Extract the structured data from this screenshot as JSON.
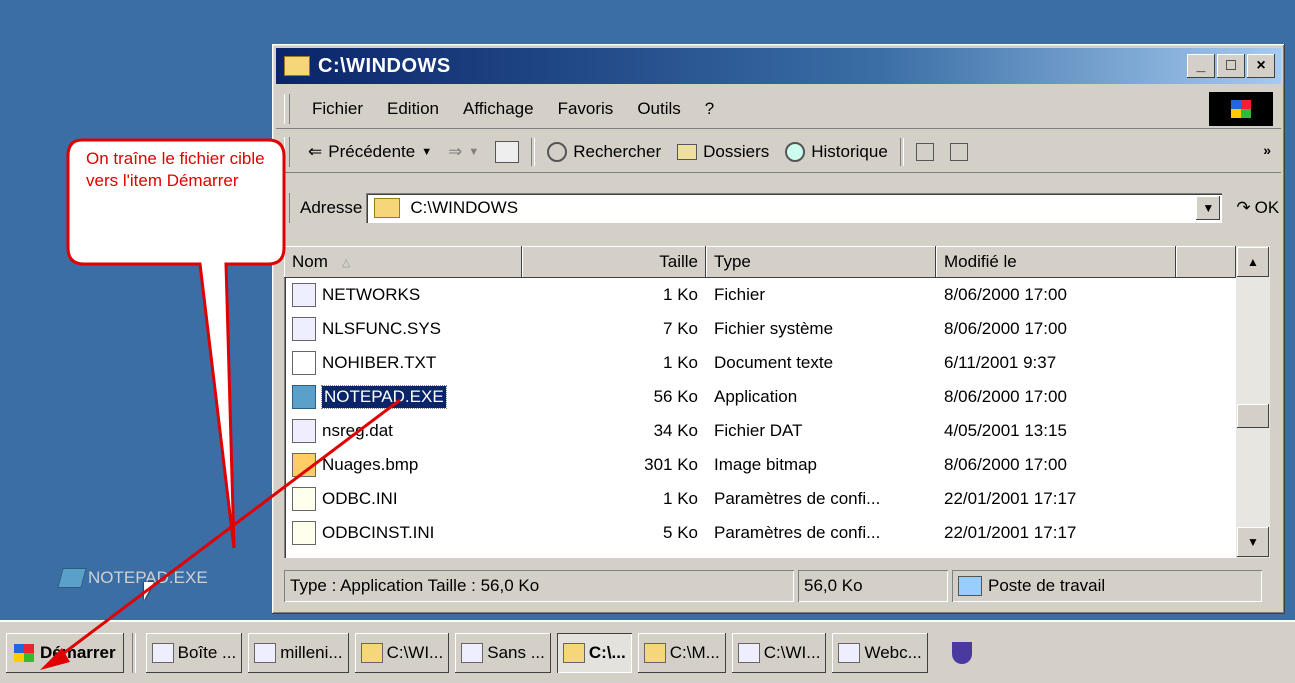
{
  "window": {
    "title": "C:\\WINDOWS",
    "min": "_",
    "max": "□",
    "close": "×"
  },
  "menu": {
    "items": [
      "Fichier",
      "Edition",
      "Affichage",
      "Favoris",
      "Outils",
      "?"
    ]
  },
  "toolbar": {
    "back": "Précédente",
    "search": "Rechercher",
    "folders": "Dossiers",
    "history": "Historique"
  },
  "address": {
    "label": "Adresse",
    "value": "C:\\WINDOWS",
    "go": "OK"
  },
  "columns": {
    "name": "Nom",
    "size": "Taille",
    "type": "Type",
    "modified": "Modifié le"
  },
  "files": [
    {
      "name": "NETWORKS",
      "size": "1 Ko",
      "type": "Fichier",
      "modified": "8/06/2000 17:00"
    },
    {
      "name": "NLSFUNC.SYS",
      "size": "7 Ko",
      "type": "Fichier système",
      "modified": "8/06/2000 17:00"
    },
    {
      "name": "NOHIBER.TXT",
      "size": "1 Ko",
      "type": "Document texte",
      "modified": "6/11/2001 9:37"
    },
    {
      "name": "NOTEPAD.EXE",
      "size": "56 Ko",
      "type": "Application",
      "modified": "8/06/2000 17:00"
    },
    {
      "name": "nsreg.dat",
      "size": "34 Ko",
      "type": "Fichier DAT",
      "modified": "4/05/2001 13:15"
    },
    {
      "name": "Nuages.bmp",
      "size": "301 Ko",
      "type": "Image bitmap",
      "modified": "8/06/2000 17:00"
    },
    {
      "name": "ODBC.INI",
      "size": "1 Ko",
      "type": "Paramètres de confi...",
      "modified": "22/01/2001 17:17"
    },
    {
      "name": "ODBCINST.INI",
      "size": "5 Ko",
      "type": "Paramètres de confi...",
      "modified": "22/01/2001 17:17"
    }
  ],
  "status": {
    "left": "Type : Application Taille : 56,0 Ko",
    "mid": "56,0 Ko",
    "right": "Poste de travail"
  },
  "callout": "On traîne le fichier cible vers l'item Démarrer",
  "desktop_icon": "NOTEPAD.EXE",
  "taskbar": {
    "start": "Démarrer",
    "tasks": [
      "Boîte ...",
      "milleni...",
      "C:\\WI...",
      "Sans ...",
      "C:\\...",
      "C:\\M...",
      "C:\\WI...",
      "Webc..."
    ]
  },
  "colors": {
    "desktop": "#3a6ea5",
    "title_bar": "#0a246a",
    "callout": "#e00000"
  }
}
